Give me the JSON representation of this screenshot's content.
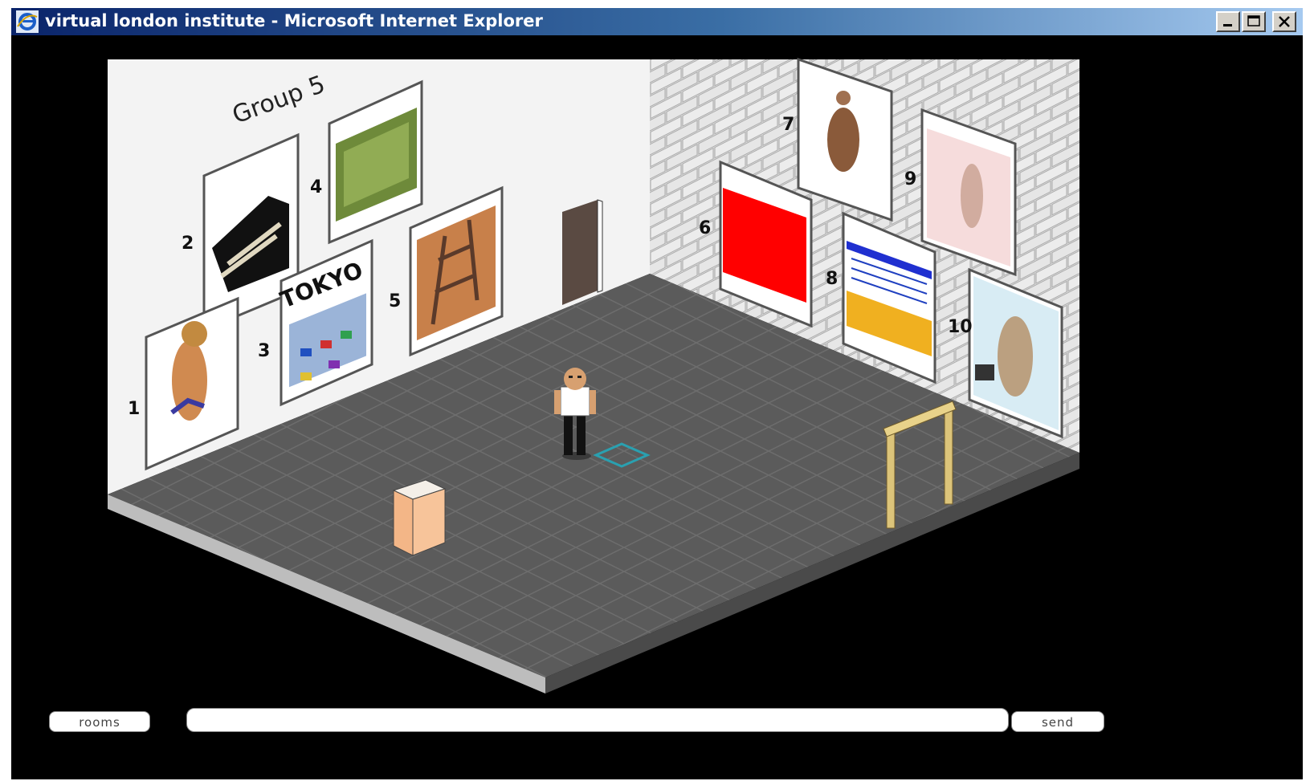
{
  "window": {
    "title": "virtual london institute - Microsoft Internet Explorer",
    "controls": [
      "minimize",
      "maximize",
      "close"
    ],
    "titlebar_colors": [
      "#0a246a",
      "#a6caf0"
    ]
  },
  "scene": {
    "wall_heading": "Group  5",
    "artwork_numbers": [
      "1",
      "2",
      "3",
      "4",
      "5",
      "6",
      "7",
      "8",
      "9",
      "10"
    ],
    "poster_text": "TOKYO"
  },
  "toolbar": {
    "rooms_label": "rooms",
    "chat_value": "",
    "send_label": "send"
  },
  "icons": {
    "app_icon": "internet-explorer-icon",
    "minimize": "minimize-icon",
    "maximize": "maximize-icon",
    "close": "close-icon"
  }
}
